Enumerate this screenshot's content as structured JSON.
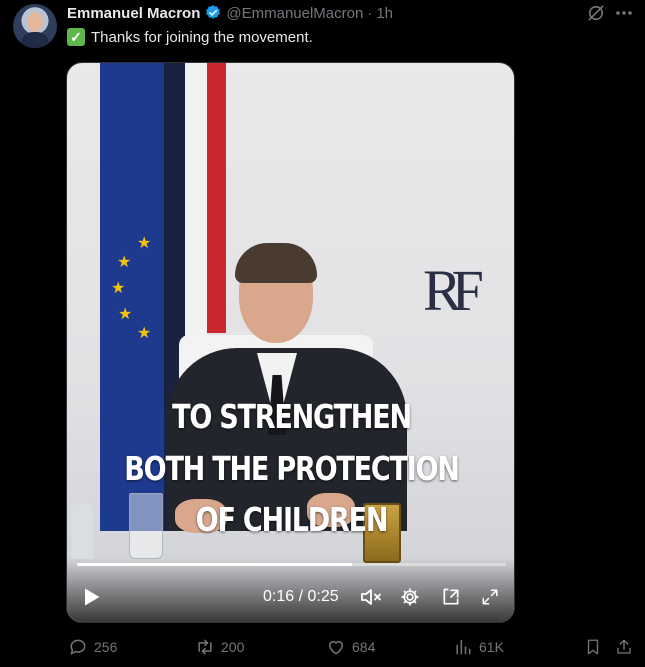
{
  "post": {
    "author_name": "Emmanuel Macron",
    "handle": "@EmmanuelMacron",
    "separator": "·",
    "time": "1h",
    "check_glyph": "✓",
    "text": "Thanks for joining the movement."
  },
  "video": {
    "caption_lines": [
      "TO STRENGTHEN",
      "BOTH THE PROTECTION",
      "OF CHILDREN"
    ],
    "monogram": "RF",
    "time_readout": "0:16 / 0:25",
    "progress": 0.64
  },
  "actions": {
    "replies": "256",
    "reposts": "200",
    "likes": "684",
    "views": "61K"
  },
  "colors": {
    "background": "#000000",
    "text": "#e7e9ea",
    "muted": "#71767b",
    "verified_badge": "#1d9bf0",
    "check_emoji": "#5fb84e",
    "flag_blue": "#1d3a8f",
    "flag_red": "#c8282e",
    "eu_star": "#f4c20d"
  },
  "icons": [
    "verified-badge-icon",
    "grok-icon",
    "more-icon",
    "check-emoji-icon",
    "play-icon",
    "mute-icon",
    "settings-icon",
    "dock-icon",
    "fullscreen-icon",
    "reply-icon",
    "repost-icon",
    "like-icon",
    "views-icon",
    "bookmark-icon",
    "share-icon"
  ]
}
